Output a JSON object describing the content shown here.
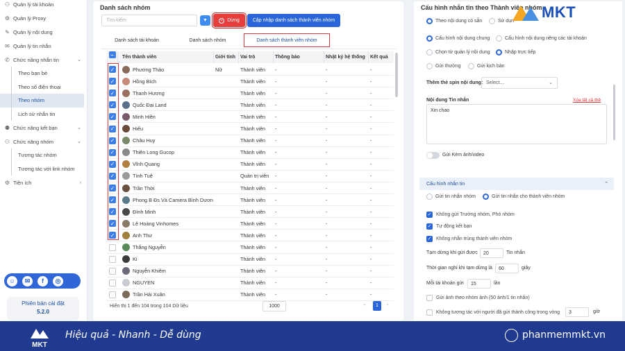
{
  "sidebar": {
    "items": [
      {
        "label": "Quản lý tài khoản",
        "icon": "user-icon",
        "type": "item"
      },
      {
        "label": "Quản lý Proxy",
        "icon": "proxy-icon",
        "type": "item"
      },
      {
        "label": "Quản lý nội dung",
        "icon": "content-icon",
        "type": "item"
      },
      {
        "label": "Quản lý tin nhắn",
        "icon": "message-icon",
        "type": "item"
      },
      {
        "label": "Chức năng nhắn tin",
        "icon": "chat-icon",
        "type": "group"
      },
      {
        "label": "Theo bạn bè",
        "type": "sub"
      },
      {
        "label": "Theo số điện thoại",
        "type": "sub"
      },
      {
        "label": "Theo nhóm",
        "type": "sub",
        "active": true
      },
      {
        "label": "Lịch sử nhắn tin",
        "type": "sub"
      },
      {
        "label": "Chức năng kết bạn",
        "icon": "add-friend-icon",
        "type": "group"
      },
      {
        "label": "Chức năng nhóm",
        "icon": "group-icon",
        "type": "group"
      },
      {
        "label": "Tương tác nhóm",
        "type": "sub"
      },
      {
        "label": "Tương tác với link nhóm",
        "type": "sub"
      },
      {
        "label": "Tiện ích",
        "icon": "utility-icon",
        "type": "group"
      }
    ],
    "version_label": "Phiên bản cài đặt",
    "version": "5.2.0"
  },
  "main": {
    "title": "Danh sách nhóm",
    "search_placeholder": "Tìm kiếm",
    "stop_label": "Dừng",
    "update_label": "Cập nhập danh sách thành viên nhóm",
    "tabs": [
      "Danh sách tài khoản",
      "Danh sách nhóm",
      "Danh sách thành viên nhóm"
    ],
    "columns": [
      "Tên thành viên",
      "Giới tính",
      "Vai trò",
      "Thông báo",
      "Nhật ký hệ thống",
      "Kết quả"
    ],
    "rows": [
      {
        "name": "Phương Thảo",
        "gender": "Nữ",
        "role": "Thành viên",
        "notice": "-",
        "log": "-",
        "result": "-",
        "checked": true,
        "color": "#8a6a5a"
      },
      {
        "name": "Hồng Bích",
        "gender": "",
        "role": "Thành viên",
        "notice": "-",
        "log": "-",
        "result": "-",
        "checked": true,
        "color": "#c48a7a"
      },
      {
        "name": "Thanh Hương",
        "gender": "",
        "role": "Thành viên",
        "notice": "-",
        "log": "-",
        "result": "-",
        "checked": true,
        "color": "#9a7060"
      },
      {
        "name": "Quốc Đại Land",
        "gender": "",
        "role": "Thành viên",
        "notice": "-",
        "log": "-",
        "result": "-",
        "checked": true,
        "color": "#5a6f8a"
      },
      {
        "name": "Minh Hiền",
        "gender": "",
        "role": "Thành viên",
        "notice": "-",
        "log": "-",
        "result": "-",
        "checked": true,
        "color": "#7a5a6a"
      },
      {
        "name": "Hiếu",
        "gender": "",
        "role": "Thành viên",
        "notice": "-",
        "log": "-",
        "result": "-",
        "checked": true,
        "color": "#6a4a3a"
      },
      {
        "name": "Châu Huy",
        "gender": "",
        "role": "Thành viên",
        "notice": "-",
        "log": "-",
        "result": "-",
        "checked": true,
        "color": "#7a8a6a"
      },
      {
        "name": "Thiên Long Gucop",
        "gender": "",
        "role": "Thành viên",
        "notice": "-",
        "log": "-",
        "result": "-",
        "checked": true,
        "color": "#8a8a8a"
      },
      {
        "name": "Vĩnh Quang",
        "gender": "",
        "role": "Thành viên",
        "notice": "-",
        "log": "-",
        "result": "-",
        "checked": true,
        "color": "#b08040"
      },
      {
        "name": "Tính Tuệ",
        "gender": "",
        "role": "Quản trị viên",
        "notice": "-",
        "log": "-",
        "result": "-",
        "checked": true,
        "color": "#9a9a9a"
      },
      {
        "name": "Trần Thời",
        "gender": "",
        "role": "Thành viên",
        "notice": "-",
        "log": "-",
        "result": "-",
        "checked": true,
        "color": "#6a5040"
      },
      {
        "name": "Phong B Đs Và Camera Bình Dươn",
        "gender": "",
        "role": "Thành viên",
        "notice": "-",
        "log": "-",
        "result": "-",
        "checked": true,
        "color": "#5a7a8a"
      },
      {
        "name": "Đình Minh",
        "gender": "",
        "role": "Thành viên",
        "notice": "-",
        "log": "-",
        "result": "-",
        "checked": true,
        "color": "#4a4a4a"
      },
      {
        "name": "Lê Hoàng Vinhomes",
        "gender": "",
        "role": "Thành viên",
        "notice": "-",
        "log": "-",
        "result": "-",
        "checked": true,
        "color": "#8a7a6a"
      },
      {
        "name": "Anh Thư",
        "gender": "",
        "role": "Thành viên",
        "notice": "-",
        "log": "-",
        "result": "-",
        "checked": true,
        "color": "#a0803a"
      },
      {
        "name": "Thắng Nguyễn",
        "gender": "",
        "role": "Thành viên",
        "notice": "-",
        "log": "-",
        "result": "-",
        "checked": false,
        "color": "#5a8a5a"
      },
      {
        "name": "Ki",
        "gender": "",
        "role": "Thành viên",
        "notice": "-",
        "log": "-",
        "result": "-",
        "checked": false,
        "color": "#3a3a3a"
      },
      {
        "name": "Nguyễn Khiêm",
        "gender": "",
        "role": "Thành viên",
        "notice": "-",
        "log": "-",
        "result": "-",
        "checked": false,
        "color": "#6a6a7a"
      },
      {
        "name": "NGUYEN",
        "gender": "",
        "role": "Thành viên",
        "notice": "-",
        "log": "-",
        "result": "-",
        "checked": false,
        "color": "#c9ccd3"
      },
      {
        "name": "Trần Hải Xuân",
        "gender": "",
        "role": "Thành viên",
        "notice": "-",
        "log": "-",
        "result": "-",
        "checked": false,
        "color": "#7a6a5a"
      }
    ],
    "footer_text": "Hiển thị 1 đến 104 trong 104 Dữ liệu",
    "page_size": "1000",
    "page_prev": "‹",
    "page_current": "1",
    "page_next": "›"
  },
  "right": {
    "title": "Cấu hình nhắn tin theo Thành viên nhóm",
    "opt_content_available": "Theo nội dung có sẵn",
    "opt_use": "Sử dụn",
    "opt_common": "Cấu hình nội dung chung",
    "opt_separate": "Cấu hình nội dung riêng các tài khoản",
    "opt_select": "Chọn từ quản lý nội dung",
    "opt_direct": "Nhập trực tiếp",
    "opt_normal": "Gửi thường",
    "opt_script": "Gửi kịch bản",
    "spin_label": "Thêm thẻ spin nội dung:",
    "spin_value": "Select...",
    "content_label": "Nội dung Tin nhắn",
    "clear_label": "Xóa tất cả thẻ",
    "message": "Xin chao",
    "attach_label": "Gửi Kèm ảnh/video",
    "section_title": "Cấu hình nhắn tin",
    "opt_send_group": "Gửi tin nhắn nhóm",
    "opt_send_member": "Gửi tin nhắn cho thành viên nhóm",
    "chk_skip_admin": "Không gửi Trưởng nhóm, Phó nhóm",
    "chk_auto_friend": "Tự động kết bạn",
    "chk_no_dup": "Không nhắn trùng thành viên nhóm",
    "pause_label": "Tạm dừng khi gửi được",
    "pause_value": "20",
    "pause_unit": "Tin nhắn",
    "rest_label": "Thời gian nghỉ khi tạm dừng là",
    "rest_value": "60",
    "rest_unit": "giây",
    "each_label": "Mỗi tài khoản gửi",
    "each_value": "15",
    "each_unit": "lần",
    "chk_photo_group": "Gửi ảnh theo nhóm ảnh (50 ảnh/1 tin nhắn)",
    "chk_no_interact": "Không tương tác với người đã gửi thành công trong vòng",
    "no_interact_value": "3",
    "no_interact_unit": "giờ"
  },
  "brand": {
    "logo": "MKT",
    "slogan": "Hiệu quả - Nhanh - Dễ dùng",
    "site": "phanmemmkt.vn"
  }
}
